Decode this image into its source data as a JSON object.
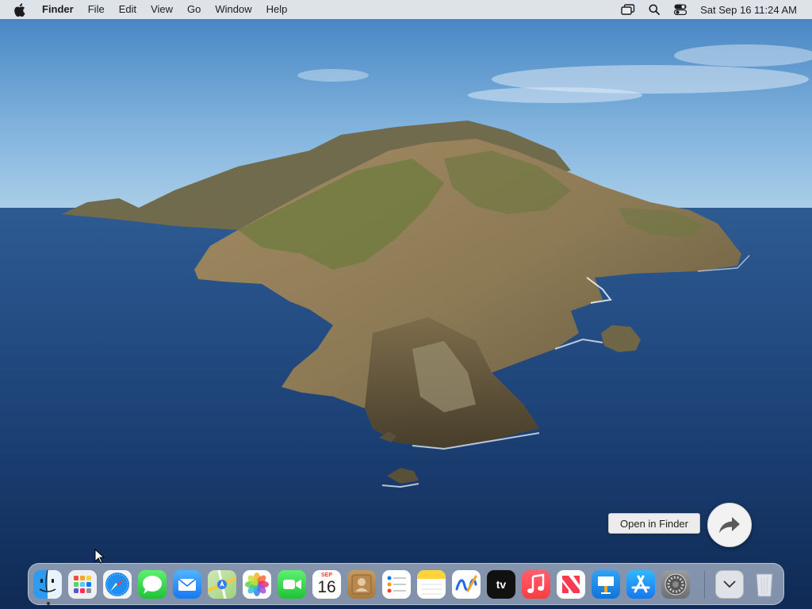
{
  "menubar": {
    "apple_icon": "apple-logo-icon",
    "app_name": "Finder",
    "menus": [
      "File",
      "Edit",
      "View",
      "Go",
      "Window",
      "Help"
    ],
    "status_icons": [
      "screen-mirroring-icon",
      "spotlight-search-icon",
      "control-center-icon"
    ],
    "clock": "Sat Sep 16  11:24 AM"
  },
  "tooltip": {
    "text": "Open in Finder"
  },
  "share_button": {
    "icon": "share-arrow-icon"
  },
  "dock": {
    "apps": [
      {
        "name": "Finder",
        "icon": "finder-icon",
        "running": true
      },
      {
        "name": "Launchpad",
        "icon": "launchpad-icon"
      },
      {
        "name": "Safari",
        "icon": "safari-icon"
      },
      {
        "name": "Messages",
        "icon": "messages-icon"
      },
      {
        "name": "Mail",
        "icon": "mail-icon"
      },
      {
        "name": "Maps",
        "icon": "maps-icon"
      },
      {
        "name": "Photos",
        "icon": "photos-icon"
      },
      {
        "name": "FaceTime",
        "icon": "facetime-icon"
      },
      {
        "name": "Calendar",
        "icon": "calendar-icon",
        "month": "SEP",
        "day": "16"
      },
      {
        "name": "Contacts",
        "icon": "contacts-icon"
      },
      {
        "name": "Reminders",
        "icon": "reminders-icon"
      },
      {
        "name": "Notes",
        "icon": "notes-icon"
      },
      {
        "name": "Freeform",
        "icon": "freeform-icon"
      },
      {
        "name": "TV",
        "icon": "apple-tv-icon",
        "label": "tv"
      },
      {
        "name": "Music",
        "icon": "music-icon"
      },
      {
        "name": "News",
        "icon": "news-icon"
      },
      {
        "name": "Keynote",
        "icon": "keynote-icon"
      },
      {
        "name": "App Store",
        "icon": "app-store-icon"
      },
      {
        "name": "System Settings",
        "icon": "system-settings-icon"
      }
    ],
    "downloads_stack": {
      "icon": "downloads-chevron-icon"
    },
    "trash": {
      "icon": "trash-icon"
    }
  }
}
